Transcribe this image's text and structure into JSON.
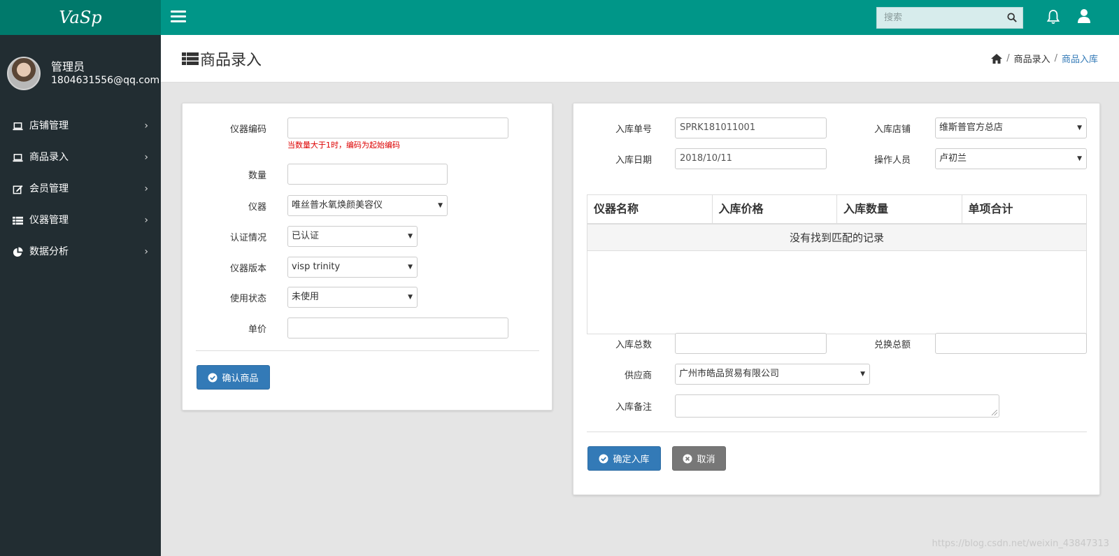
{
  "app": {
    "logo": "VaSp"
  },
  "topbar": {
    "search_placeholder": "搜索"
  },
  "user": {
    "name": "管理员",
    "email": "1804631556@qq.com"
  },
  "sidebar": {
    "items": [
      {
        "label": "店铺管理",
        "icon": "laptop-icon"
      },
      {
        "label": "商品录入",
        "icon": "laptop-icon"
      },
      {
        "label": "会员管理",
        "icon": "edit-icon"
      },
      {
        "label": "仪器管理",
        "icon": "list-icon"
      },
      {
        "label": "数据分析",
        "icon": "pie-chart-icon"
      }
    ]
  },
  "header": {
    "title": "商品录入",
    "breadcrumb": [
      "商品录入",
      "商品入库"
    ]
  },
  "left_form": {
    "code_label": "仪器编码",
    "code_value": "",
    "code_hint": "当数量大于1时，编码为起始编码",
    "qty_label": "数量",
    "qty_value": "",
    "device_label": "仪器",
    "device_value": "唯丝普水氧焕颜美容仪",
    "cert_label": "认证情况",
    "cert_value": "已认证",
    "version_label": "仪器版本",
    "version_value": "visp trinity",
    "status_label": "使用状态",
    "status_value": "未使用",
    "price_label": "单价",
    "price_value": "",
    "confirm_button": "确认商品"
  },
  "right_form": {
    "order_label": "入库单号",
    "order_value": "SPRK181011001",
    "store_label": "入库店铺",
    "store_value": "维斯普官方总店",
    "date_label": "入库日期",
    "date_value": "2018/10/11",
    "operator_label": "操作人员",
    "operator_value": "卢初兰",
    "table": {
      "columns": [
        "仪器名称",
        "入库价格",
        "入库数量",
        "单项合计"
      ],
      "empty_text": "没有找到匹配的记录"
    },
    "total_qty_label": "入库总数",
    "total_qty_value": "",
    "exchange_label": "兑换总额",
    "exchange_value": "",
    "supplier_label": "供应商",
    "supplier_value": "广州市皓品贸易有限公司",
    "remark_label": "入库备注",
    "confirm_button": "确定入库",
    "cancel_button": "取消"
  },
  "watermark": "https://blog.csdn.net/weixin_43847313",
  "colors": {
    "topbar": "#009688",
    "logo_bg": "#00796b",
    "sidebar": "#222d32",
    "primary": "#337ab7"
  }
}
